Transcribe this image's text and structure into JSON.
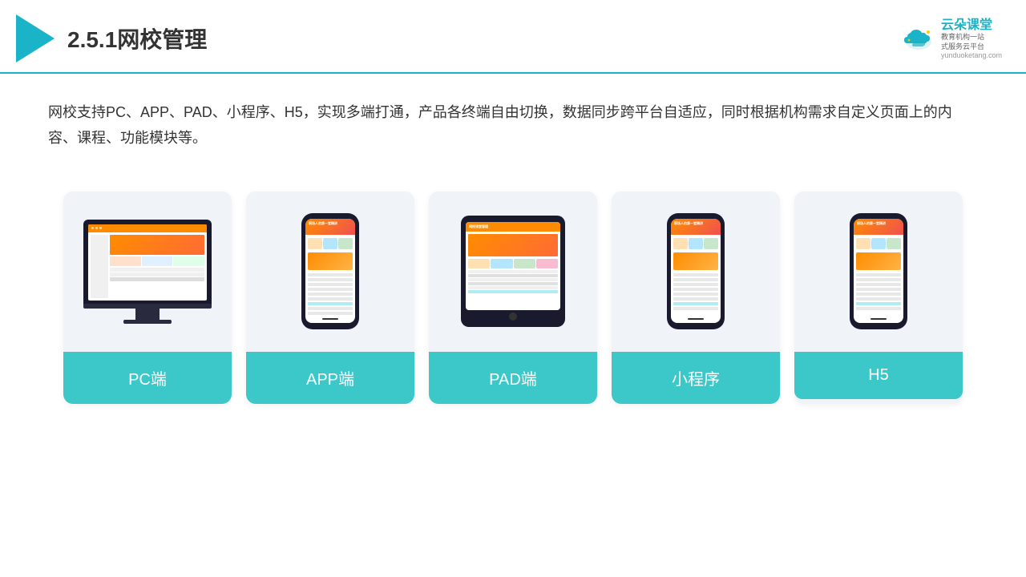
{
  "header": {
    "title": "2.5.1网校管理",
    "brand": {
      "name": "云朵课堂",
      "tagline": "教育机构一站\n式服务云平台",
      "domain": "yunduoketang.com"
    }
  },
  "description": "网校支持PC、APP、PAD、小程序、H5，实现多端打通，产品各终端自由切换，数据同步跨平台自适应，同时根据机构需求自定义页面上的内容、课程、功能模块等。",
  "cards": [
    {
      "id": "pc",
      "label": "PC端"
    },
    {
      "id": "app",
      "label": "APP端"
    },
    {
      "id": "pad",
      "label": "PAD端"
    },
    {
      "id": "miniapp",
      "label": "小程序"
    },
    {
      "id": "h5",
      "label": "H5"
    }
  ],
  "colors": {
    "teal": "#3cc8c8",
    "accent": "#1ab3c8"
  }
}
